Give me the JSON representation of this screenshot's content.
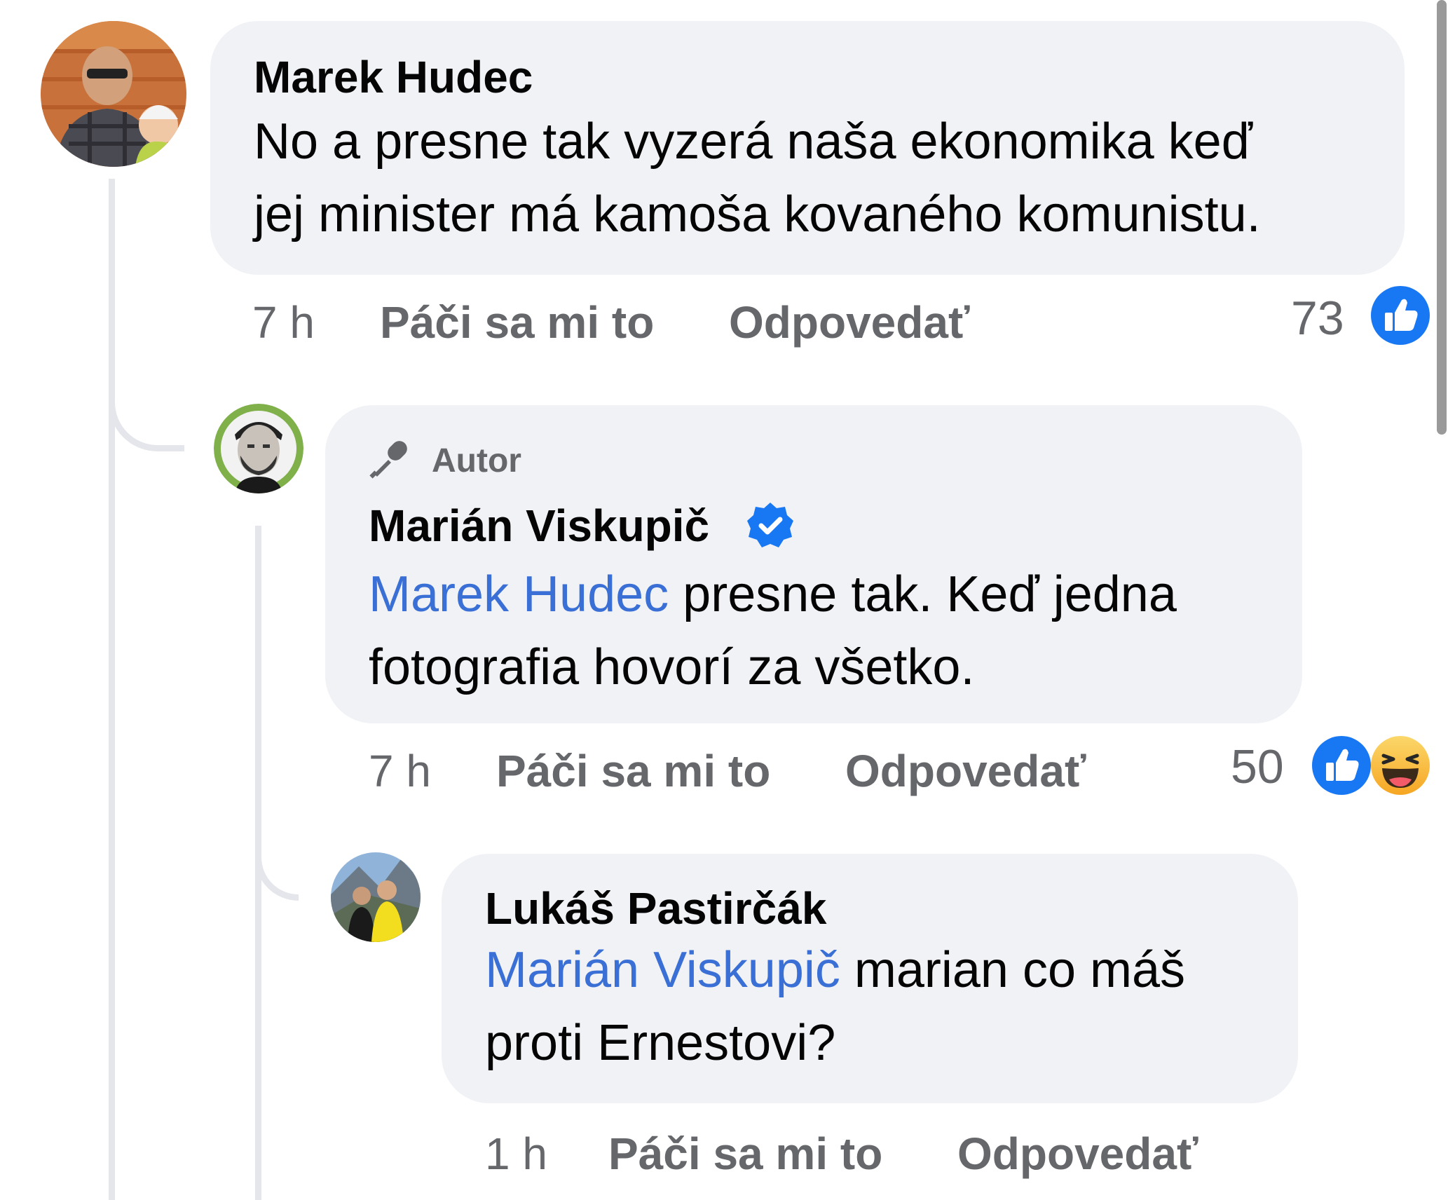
{
  "comments": [
    {
      "author": "Marek Hudec",
      "text_lines": [
        "No a presne tak vyzerá naša ekonomika keď",
        "jej minister má kamoša kovaného komunistu."
      ],
      "time": "7 h",
      "like_label": "Páči sa mi to",
      "reply_label": "Odpovedať",
      "reaction_count": "73",
      "reactions": [
        "like-icon"
      ]
    },
    {
      "badge": "Autor",
      "author": "Marián Viskupič",
      "verified": true,
      "mention": "Marek Hudec",
      "text_line1_rest": " presne tak. Keď jedna",
      "text_line2": "fotografia hovorí za všetko.",
      "time": "7 h",
      "like_label": "Páči sa mi to",
      "reply_label": "Odpovedať",
      "reaction_count": "50",
      "reactions": [
        "like-icon",
        "haha-icon"
      ]
    },
    {
      "author": "Lukáš Pastirčák",
      "mention": "Marián Viskupič",
      "text_line1_rest": " marian co máš",
      "text_line2": "proti Ernestovi?",
      "time": "1 h",
      "like_label": "Páči sa mi to",
      "reply_label": "Odpovedať"
    }
  ],
  "colors": {
    "bubble": "#f0f2f5",
    "mention": "#3a6fd6",
    "like_blue": "#1877f2",
    "meta_gray": "#65676b"
  }
}
